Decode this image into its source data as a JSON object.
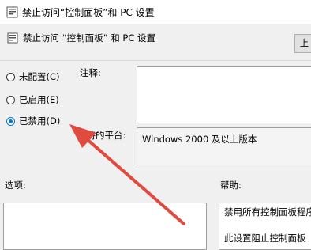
{
  "window": {
    "title": "禁止访问“控制面板”和 PC 设置"
  },
  "header": {
    "policy_title": "禁止访问 “控制面板” 和 PC 设置",
    "prev_button": "上"
  },
  "state": {
    "options": [
      {
        "label": "未配置(C)",
        "selected": false
      },
      {
        "label": "已启用(E)",
        "selected": false
      },
      {
        "label": "已禁用(D)",
        "selected": true
      }
    ]
  },
  "comment": {
    "label": "注释:",
    "value": ""
  },
  "platform": {
    "label": "支持的平台:",
    "value": "Windows 2000 及以上版本"
  },
  "options_section": {
    "label": "选项:"
  },
  "help_section": {
    "label": "帮助:",
    "lines": [
      "禁用所有控制面板程序",
      "此设置阻止控制面板"
    ]
  },
  "colors": {
    "arrow": "#e04a3f",
    "accent": "#0078d7"
  }
}
